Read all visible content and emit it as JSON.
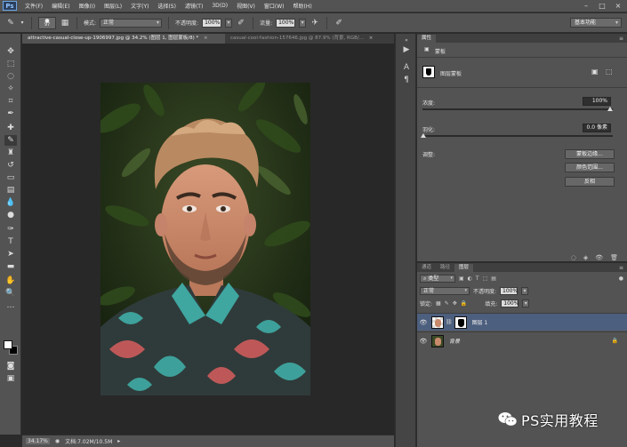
{
  "app": {
    "logo": "Ps",
    "menu": [
      "文件(F)",
      "编辑(E)",
      "图像(I)",
      "图层(L)",
      "文字(Y)",
      "选择(S)",
      "滤镜(T)",
      "3D(D)",
      "视图(V)",
      "窗口(W)",
      "帮助(H)"
    ],
    "window_controls": [
      "–",
      "□",
      "×"
    ]
  },
  "options": {
    "brush_size": "97",
    "mode_label": "模式:",
    "mode_value": "正常",
    "opacity_label": "不透明度:",
    "opacity_value": "100%",
    "flow_label": "流量:",
    "flow_value": "100%",
    "workspace": "基本功能"
  },
  "tabs": [
    {
      "label": "attractive-casual-close-up-1906997.jpg @ 34.2% (图层 1, 图层蒙板/8) *",
      "close": "×"
    },
    {
      "label": "casual-cool-fashion-157646.jpg @ 87.9% (背景, RGB/...",
      "close": "×"
    }
  ],
  "status": {
    "zoom": "34.17%",
    "doc_info": "文档:7.02M/10.5M"
  },
  "properties": {
    "tab_label": "属性",
    "panel_title": "蒙板",
    "mask_label": "图层蒙板",
    "density_label": "浓度:",
    "density_value": "100%",
    "feather_label": "羽化:",
    "feather_value": "0.0 像素",
    "adjust_label": "调整:",
    "buttons": [
      "蒙板边缘...",
      "颜色范围...",
      "反相"
    ]
  },
  "layers": {
    "tabs": [
      "通道",
      "路径",
      "图层"
    ],
    "kind_label": "类型",
    "blend_mode": "正常",
    "opacity_label": "不透明度:",
    "opacity_value": "100%",
    "lock_label": "锁定:",
    "fill_label": "填充:",
    "fill_value": "100%",
    "rows": [
      {
        "name": "图层 1",
        "selected": true
      },
      {
        "name": "背景",
        "selected": false
      }
    ]
  },
  "watermark": {
    "text": "PS实用教程"
  }
}
